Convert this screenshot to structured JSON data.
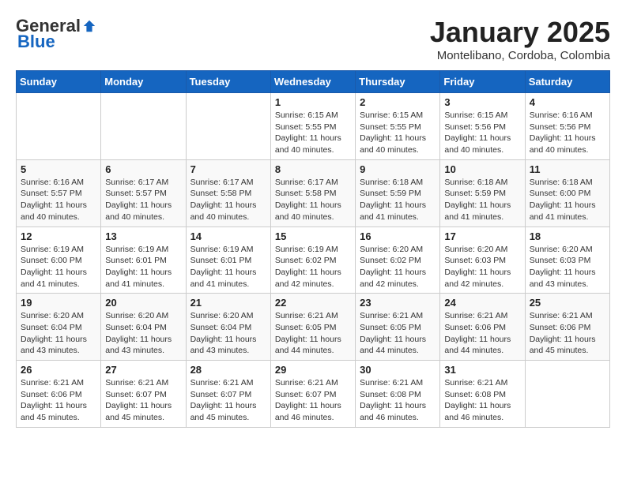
{
  "header": {
    "logo_general": "General",
    "logo_blue": "Blue",
    "month_title": "January 2025",
    "subtitle": "Montelibano, Cordoba, Colombia"
  },
  "weekdays": [
    "Sunday",
    "Monday",
    "Tuesday",
    "Wednesday",
    "Thursday",
    "Friday",
    "Saturday"
  ],
  "weeks": [
    [
      {
        "day": "",
        "sunrise": "",
        "sunset": "",
        "daylight": ""
      },
      {
        "day": "",
        "sunrise": "",
        "sunset": "",
        "daylight": ""
      },
      {
        "day": "",
        "sunrise": "",
        "sunset": "",
        "daylight": ""
      },
      {
        "day": "1",
        "sunrise": "Sunrise: 6:15 AM",
        "sunset": "Sunset: 5:55 PM",
        "daylight": "Daylight: 11 hours and 40 minutes."
      },
      {
        "day": "2",
        "sunrise": "Sunrise: 6:15 AM",
        "sunset": "Sunset: 5:55 PM",
        "daylight": "Daylight: 11 hours and 40 minutes."
      },
      {
        "day": "3",
        "sunrise": "Sunrise: 6:15 AM",
        "sunset": "Sunset: 5:56 PM",
        "daylight": "Daylight: 11 hours and 40 minutes."
      },
      {
        "day": "4",
        "sunrise": "Sunrise: 6:16 AM",
        "sunset": "Sunset: 5:56 PM",
        "daylight": "Daylight: 11 hours and 40 minutes."
      }
    ],
    [
      {
        "day": "5",
        "sunrise": "Sunrise: 6:16 AM",
        "sunset": "Sunset: 5:57 PM",
        "daylight": "Daylight: 11 hours and 40 minutes."
      },
      {
        "day": "6",
        "sunrise": "Sunrise: 6:17 AM",
        "sunset": "Sunset: 5:57 PM",
        "daylight": "Daylight: 11 hours and 40 minutes."
      },
      {
        "day": "7",
        "sunrise": "Sunrise: 6:17 AM",
        "sunset": "Sunset: 5:58 PM",
        "daylight": "Daylight: 11 hours and 40 minutes."
      },
      {
        "day": "8",
        "sunrise": "Sunrise: 6:17 AM",
        "sunset": "Sunset: 5:58 PM",
        "daylight": "Daylight: 11 hours and 40 minutes."
      },
      {
        "day": "9",
        "sunrise": "Sunrise: 6:18 AM",
        "sunset": "Sunset: 5:59 PM",
        "daylight": "Daylight: 11 hours and 41 minutes."
      },
      {
        "day": "10",
        "sunrise": "Sunrise: 6:18 AM",
        "sunset": "Sunset: 5:59 PM",
        "daylight": "Daylight: 11 hours and 41 minutes."
      },
      {
        "day": "11",
        "sunrise": "Sunrise: 6:18 AM",
        "sunset": "Sunset: 6:00 PM",
        "daylight": "Daylight: 11 hours and 41 minutes."
      }
    ],
    [
      {
        "day": "12",
        "sunrise": "Sunrise: 6:19 AM",
        "sunset": "Sunset: 6:00 PM",
        "daylight": "Daylight: 11 hours and 41 minutes."
      },
      {
        "day": "13",
        "sunrise": "Sunrise: 6:19 AM",
        "sunset": "Sunset: 6:01 PM",
        "daylight": "Daylight: 11 hours and 41 minutes."
      },
      {
        "day": "14",
        "sunrise": "Sunrise: 6:19 AM",
        "sunset": "Sunset: 6:01 PM",
        "daylight": "Daylight: 11 hours and 41 minutes."
      },
      {
        "day": "15",
        "sunrise": "Sunrise: 6:19 AM",
        "sunset": "Sunset: 6:02 PM",
        "daylight": "Daylight: 11 hours and 42 minutes."
      },
      {
        "day": "16",
        "sunrise": "Sunrise: 6:20 AM",
        "sunset": "Sunset: 6:02 PM",
        "daylight": "Daylight: 11 hours and 42 minutes."
      },
      {
        "day": "17",
        "sunrise": "Sunrise: 6:20 AM",
        "sunset": "Sunset: 6:03 PM",
        "daylight": "Daylight: 11 hours and 42 minutes."
      },
      {
        "day": "18",
        "sunrise": "Sunrise: 6:20 AM",
        "sunset": "Sunset: 6:03 PM",
        "daylight": "Daylight: 11 hours and 43 minutes."
      }
    ],
    [
      {
        "day": "19",
        "sunrise": "Sunrise: 6:20 AM",
        "sunset": "Sunset: 6:04 PM",
        "daylight": "Daylight: 11 hours and 43 minutes."
      },
      {
        "day": "20",
        "sunrise": "Sunrise: 6:20 AM",
        "sunset": "Sunset: 6:04 PM",
        "daylight": "Daylight: 11 hours and 43 minutes."
      },
      {
        "day": "21",
        "sunrise": "Sunrise: 6:20 AM",
        "sunset": "Sunset: 6:04 PM",
        "daylight": "Daylight: 11 hours and 43 minutes."
      },
      {
        "day": "22",
        "sunrise": "Sunrise: 6:21 AM",
        "sunset": "Sunset: 6:05 PM",
        "daylight": "Daylight: 11 hours and 44 minutes."
      },
      {
        "day": "23",
        "sunrise": "Sunrise: 6:21 AM",
        "sunset": "Sunset: 6:05 PM",
        "daylight": "Daylight: 11 hours and 44 minutes."
      },
      {
        "day": "24",
        "sunrise": "Sunrise: 6:21 AM",
        "sunset": "Sunset: 6:06 PM",
        "daylight": "Daylight: 11 hours and 44 minutes."
      },
      {
        "day": "25",
        "sunrise": "Sunrise: 6:21 AM",
        "sunset": "Sunset: 6:06 PM",
        "daylight": "Daylight: 11 hours and 45 minutes."
      }
    ],
    [
      {
        "day": "26",
        "sunrise": "Sunrise: 6:21 AM",
        "sunset": "Sunset: 6:06 PM",
        "daylight": "Daylight: 11 hours and 45 minutes."
      },
      {
        "day": "27",
        "sunrise": "Sunrise: 6:21 AM",
        "sunset": "Sunset: 6:07 PM",
        "daylight": "Daylight: 11 hours and 45 minutes."
      },
      {
        "day": "28",
        "sunrise": "Sunrise: 6:21 AM",
        "sunset": "Sunset: 6:07 PM",
        "daylight": "Daylight: 11 hours and 45 minutes."
      },
      {
        "day": "29",
        "sunrise": "Sunrise: 6:21 AM",
        "sunset": "Sunset: 6:07 PM",
        "daylight": "Daylight: 11 hours and 46 minutes."
      },
      {
        "day": "30",
        "sunrise": "Sunrise: 6:21 AM",
        "sunset": "Sunset: 6:08 PM",
        "daylight": "Daylight: 11 hours and 46 minutes."
      },
      {
        "day": "31",
        "sunrise": "Sunrise: 6:21 AM",
        "sunset": "Sunset: 6:08 PM",
        "daylight": "Daylight: 11 hours and 46 minutes."
      },
      {
        "day": "",
        "sunrise": "",
        "sunset": "",
        "daylight": ""
      }
    ]
  ]
}
